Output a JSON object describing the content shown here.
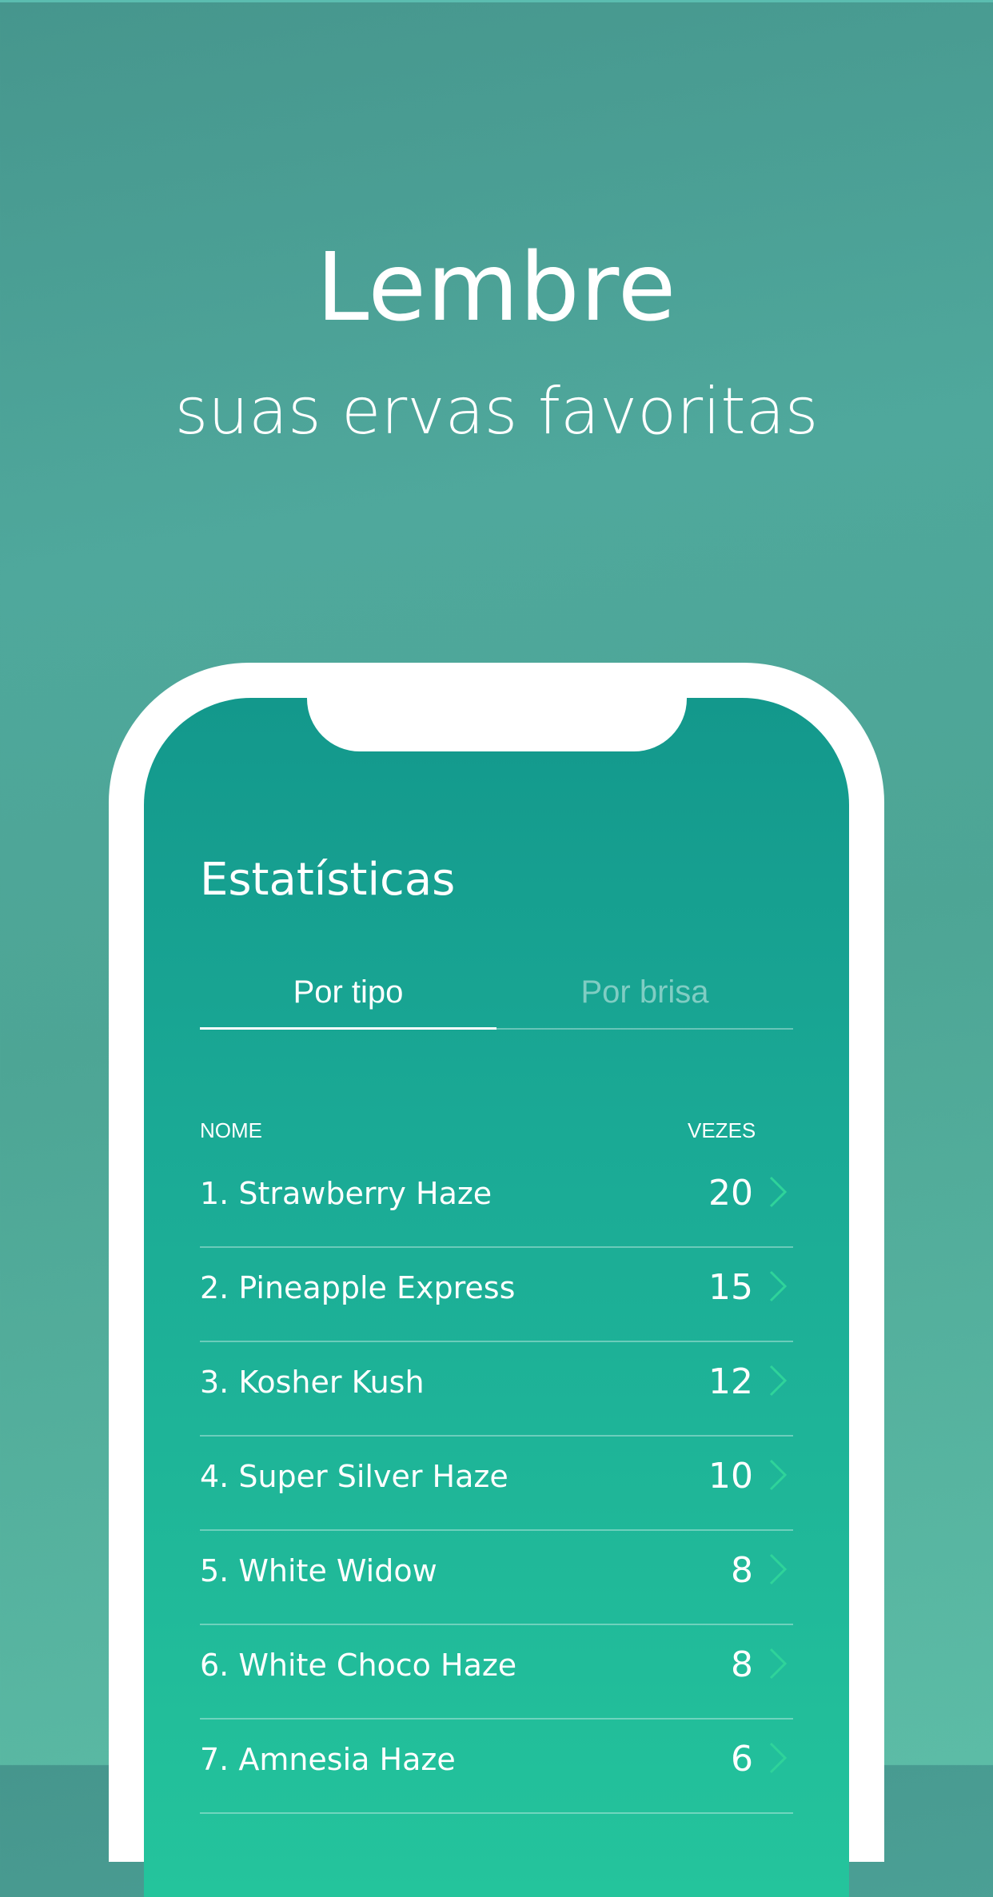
{
  "promo": {
    "title": "Lembre",
    "subtitle": "suas ervas favoritas"
  },
  "screen": {
    "title": "Estatísticas",
    "tabs": [
      {
        "label": "Por tipo",
        "active": true
      },
      {
        "label": "Por brisa",
        "active": false
      }
    ],
    "columns": {
      "name": "NOME",
      "count": "VEZES"
    },
    "rows": [
      {
        "label": "1. Strawberry Haze",
        "value": "20"
      },
      {
        "label": "2. Pineapple Express",
        "value": "15"
      },
      {
        "label": "3. Kosher Kush",
        "value": "12"
      },
      {
        "label": "4. Super Silver Haze",
        "value": "10"
      },
      {
        "label": "5. White Widow",
        "value": "8"
      },
      {
        "label": "6. White Choco Haze",
        "value": "8"
      },
      {
        "label": "7. Amnesia Haze",
        "value": "6"
      }
    ],
    "row_icon": "chevron-right-icon"
  },
  "colors": {
    "background": "#4fa89c",
    "screen_top": "#13988c",
    "screen_bottom": "#24c49c",
    "chevron": "#2fd39a",
    "text": "#ffffff"
  }
}
